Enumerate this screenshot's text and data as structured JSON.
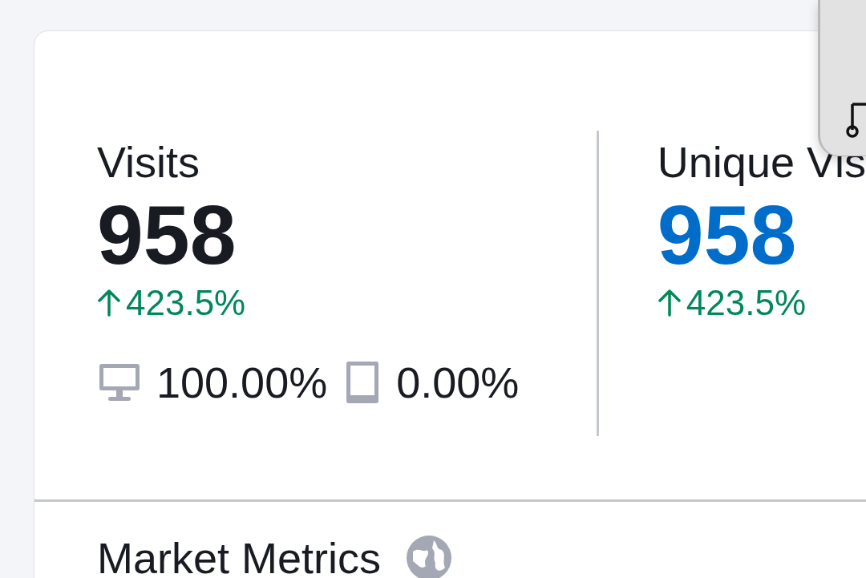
{
  "stats": [
    {
      "label": "Visits",
      "value": "958",
      "kind": "plain",
      "change": "423.5%",
      "devices": [
        {
          "kind": "desktop",
          "share": "100.00%"
        },
        {
          "kind": "mobile",
          "share": "0.00%"
        }
      ]
    },
    {
      "label": "Unique Vis",
      "value": "958",
      "kind": "link",
      "change": "423.5%"
    }
  ],
  "section": {
    "title": "Market Metrics"
  }
}
